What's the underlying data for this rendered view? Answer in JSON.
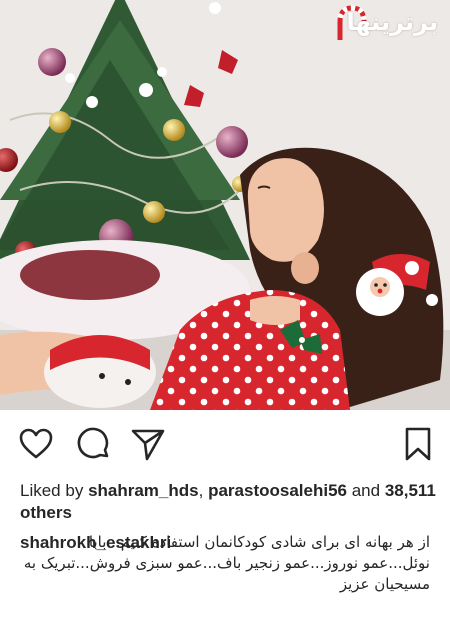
{
  "watermark": "برترینها",
  "post": {
    "image_alt": "Little girl in red polka-dot dress looking up at a decorated Christmas tree",
    "likes_prefix": "Liked by",
    "liked_by": [
      "shahram_hds",
      "parastoosalehi56"
    ],
    "likes_separator": ",",
    "likes_and": "and",
    "likes_others": "38,511 others",
    "caption_user": "shahrokh_estakhri",
    "caption_text": "از هر بهانه ای برای شادی کودکانمان استفاده کنیم...بابا نوئل...عمو نوروز...عمو زنجیر باف...عمو سبزی فروش...تبریک به مسیحیان عزیز"
  },
  "icons": {
    "like": "heart-icon",
    "comment": "comment-bubble-icon",
    "share": "paper-plane-icon",
    "save": "bookmark-icon"
  },
  "colors": {
    "text": "#262626",
    "dress_red": "#d8262f",
    "tree_green": "#2f5a34"
  }
}
